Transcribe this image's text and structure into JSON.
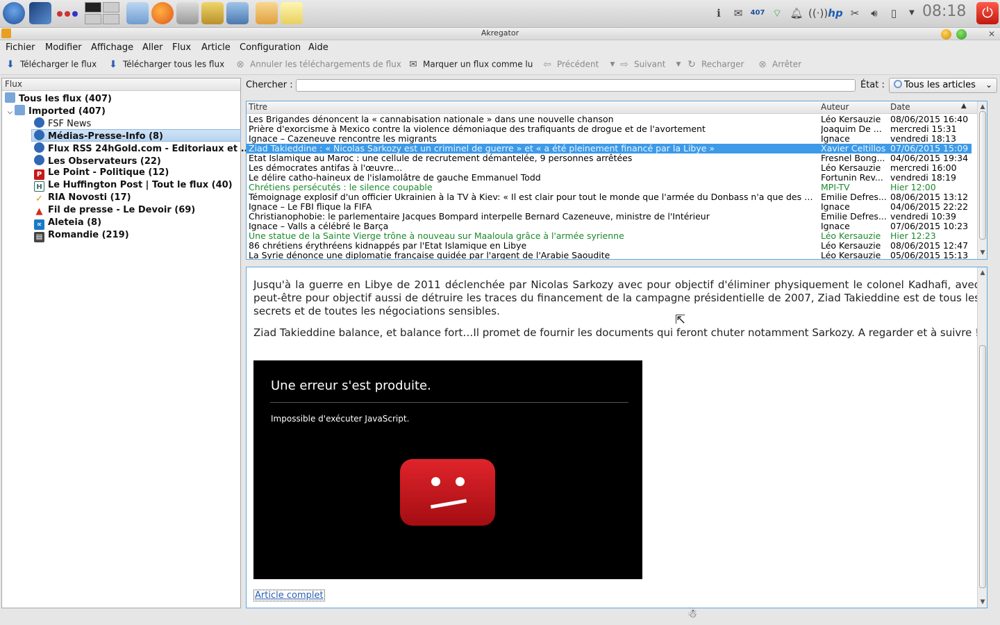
{
  "window": {
    "title": "Akregator"
  },
  "panel": {
    "notification_count": "407",
    "clock": "08:18"
  },
  "menu": [
    "Fichier",
    "Modifier",
    "Affichage",
    "Aller",
    "Flux",
    "Article",
    "Configuration",
    "Aide"
  ],
  "toolbar": {
    "fetch_feed": "Télécharger le flux",
    "fetch_all": "Télécharger tous les flux",
    "abort": "Annuler les téléchargements de flux",
    "mark_read": "Marquer un flux comme lu",
    "previous": "Précédent",
    "next": "Suivant",
    "reload": "Recharger",
    "stop": "Arrêter"
  },
  "feeds": {
    "header": "Flux",
    "items": [
      {
        "label": "Tous les flux (407)",
        "icon": "folder-icon"
      },
      {
        "label": "Imported (407)",
        "icon": "folder-icon"
      },
      {
        "label": "FSF News",
        "icon": "globe-icon"
      },
      {
        "label": "Médias-Presse-Info (8)",
        "icon": "globe-icon"
      },
      {
        "label": "Flux RSS 24hGold.com - Editoriaux et ...",
        "icon": "globe-icon"
      },
      {
        "label": "Les Observateurs (22)",
        "icon": "globe-icon"
      },
      {
        "label": "Le Point - Politique (12)",
        "icon": "lepoint-icon"
      },
      {
        "label": "Le Huffington Post | Tout le flux (40)",
        "icon": "huffpost-icon"
      },
      {
        "label": "RIA Novosti (17)",
        "icon": "ria-icon"
      },
      {
        "label": "Fil de presse - Le Devoir (69)",
        "icon": "devoir-icon"
      },
      {
        "label": "Aleteia (8)",
        "icon": "aleteia-icon"
      },
      {
        "label": "Romandie (219)",
        "icon": "romandie-icon"
      }
    ]
  },
  "search": {
    "label": "Chercher :",
    "value": ""
  },
  "status": {
    "label": "État :",
    "value": "Tous les articles"
  },
  "articles": {
    "columns": {
      "title": "Titre",
      "author": "Auteur",
      "date": "Date"
    },
    "rows": [
      {
        "title": "Les Brigandes dénoncent la « cannabisation nationale » dans une nouvelle chanson",
        "author": "Léo Kersauzie",
        "date": "08/06/2015 16:40"
      },
      {
        "title": "Prière d'exorcisme à Mexico contre la violence démoniaque des trafiquants de drogue et de l'avortement",
        "author": "Joaquim De ...",
        "date": "mercredi 15:31"
      },
      {
        "title": "Ignace – Cazeneuve rencontre les migrants",
        "author": "Ignace",
        "date": "vendredi 18:13"
      },
      {
        "title": "Ziad Takieddine : « Nicolas Sarkozy est un criminel de guerre » et « a été pleinement financé par la Libye »",
        "author": "Xavier Celtillos",
        "date": "07/06/2015 15:09"
      },
      {
        "title": "Etat Islamique au Maroc : une cellule de recrutement démantelée, 9 personnes arrêtées",
        "author": "Fresnel Bong...",
        "date": "04/06/2015 19:34"
      },
      {
        "title": "Les démocrates antifas à l'œuvre…",
        "author": "Léo Kersauzie",
        "date": "mercredi 16:00"
      },
      {
        "title": "Le délire catho-haineux de l'islamolâtre de gauche Emmanuel Todd",
        "author": "Fortunin Rev...",
        "date": "vendredi 18:19"
      },
      {
        "title": "Chrétiens persécutés : le silence coupable",
        "author": "MPI-TV",
        "date": "Hier 12:00"
      },
      {
        "title": "Témoignage explosif d'un officier Ukrainien à la TV à Kiev: « Il est clair pour tout le monde que l'armée du Donbass n'a que des b...",
        "author": "Emilie Defres...",
        "date": "08/06/2015 13:12"
      },
      {
        "title": "Ignace – Le FBI flique la FIFA",
        "author": "Ignace",
        "date": "04/06/2015 22:22"
      },
      {
        "title": "Christianophobie: le parlementaire Jacques Bompard interpelle Bernard Cazeneuve, ministre de l'Intérieur",
        "author": "Emilie Defres...",
        "date": "vendredi 10:39"
      },
      {
        "title": "Ignace – Valls a célébré le Barça",
        "author": "Ignace",
        "date": "07/06/2015 10:23"
      },
      {
        "title": "Une statue de la Sainte Vierge trône à nouveau sur Maaloula grâce à l'armée syrienne",
        "author": "Léo Kersauzie",
        "date": "Hier 12:23"
      },
      {
        "title": "86 chrétiens érythréens kidnappés par l'Etat Islamique en Libye",
        "author": "Léo Kersauzie",
        "date": "08/06/2015 12:47"
      },
      {
        "title": "La Syrie dénonce une diplomatie française guidée par l'argent de l'Arabie Saoudite",
        "author": "Léo Kersauzie",
        "date": "05/06/2015 15:13"
      }
    ]
  },
  "article": {
    "paragraph1": "Jusqu'à la guerre en Libye de 2011 déclenchée par Nicolas Sarkozy avec pour objectif d'éliminer physiquement le colonel Kadhafi, avec peut-être pour objectif aussi de détruire les traces du financement de la campagne présidentielle de 2007, Ziad Takieddine est de tous les secrets et de toutes les négociations sensibles.",
    "paragraph2": "Ziad Takieddine balance, et balance fort…Il promet de fournir les documents qui feront chuter notamment Sarkozy. A regarder et à suivre !",
    "video_error_title": "Une erreur s'est produite.",
    "video_error_message": "Impossible d'exécuter JavaScript.",
    "full_article_link": "Article complet"
  },
  "colors": {
    "selection": "#3d9ae8",
    "new_article": "#1a8a2a",
    "video_error_red": "#d31b22"
  }
}
